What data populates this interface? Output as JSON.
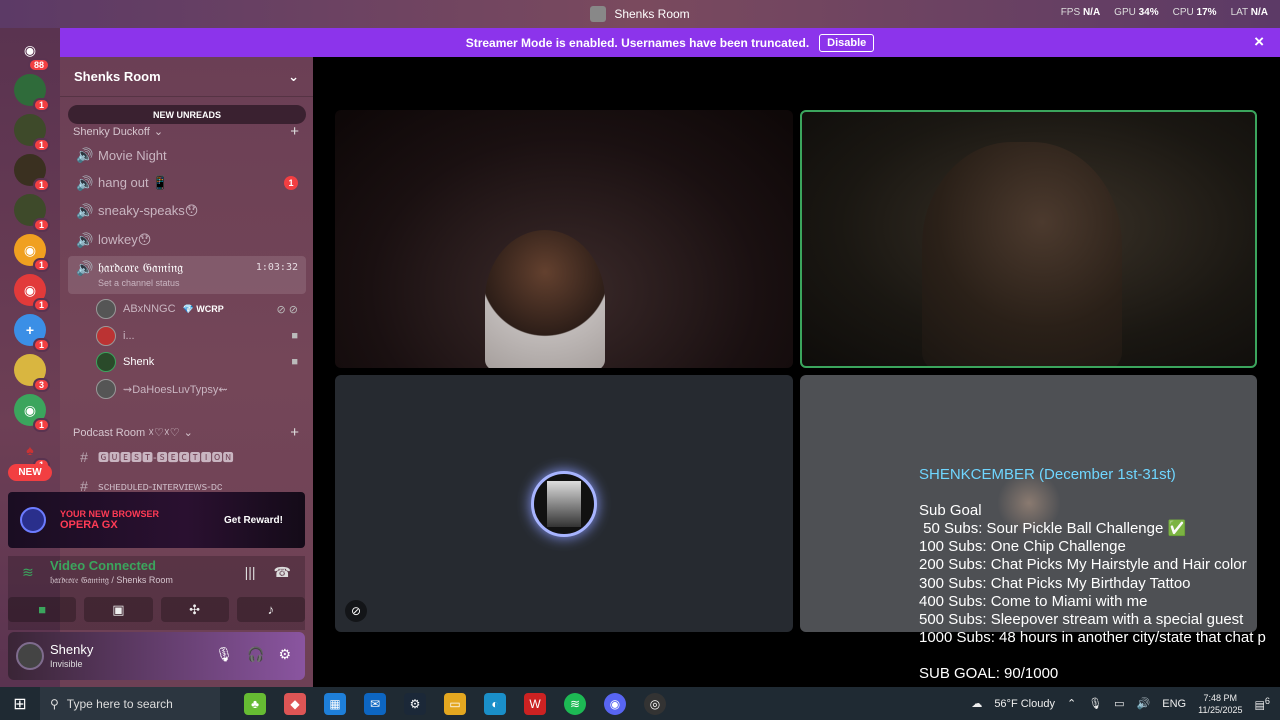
{
  "window": {
    "title": "Shenks Room"
  },
  "perf": {
    "fps_label": "FPS",
    "fps": "N/A",
    "gpu_label": "GPU",
    "gpu": "34%",
    "cpu_label": "CPU",
    "cpu": "17%",
    "lat_label": "LAT",
    "lat": "N/A"
  },
  "banner": {
    "message": "Streamer Mode is enabled. Usernames have been truncated.",
    "disable": "Disable",
    "close": "×"
  },
  "rail": {
    "home_badge": "88",
    "servers": [
      {
        "label": "1",
        "badge": "1"
      },
      {
        "label": "1",
        "badge": "1"
      },
      {
        "label": "1",
        "badge": "1"
      },
      {
        "label": "1",
        "badge": "1"
      },
      {
        "label": "1",
        "badge": "1"
      },
      {
        "label": "1",
        "badge": "1"
      },
      {
        "label": "1",
        "badge": "1"
      },
      {
        "label": "3",
        "badge": "3"
      },
      {
        "label": "1",
        "badge": "1"
      },
      {
        "label": "1",
        "badge": "1"
      }
    ],
    "new_label": "NEW"
  },
  "sidebar": {
    "server_name": "Shenks Room",
    "new_unreads": "NEW UNREADS",
    "category1": "Shenky Duckoff",
    "channels": [
      {
        "name": "Movie Night"
      },
      {
        "name": "hang out 📱",
        "badge": "1"
      },
      {
        "name": "sneaky-speaks😯"
      },
      {
        "name": "lowkey😯"
      }
    ],
    "active_channel": {
      "name": "𝔥𝔞𝔯𝔡𝔠𝔬𝔯𝔢 𝔊𝔞𝔪𝔦𝔫𝔤",
      "timer": "1:03:32",
      "status": "Set a channel status"
    },
    "voice_users": [
      {
        "name": "ABxNNGC",
        "tag": "💎 WCRP"
      },
      {
        "name": "i..."
      },
      {
        "name": "Shenk"
      },
      {
        "name": "⇝DaHoesLuvTypsy⇜"
      }
    ],
    "category2": "Podcast Room ☓♡☓♡",
    "text_channels": [
      {
        "name": "🅶🆄🅴🆂🆃-🆂🅴🅲🆃🅸🅾🅽"
      },
      {
        "name": "ꜱᴄʜᴇᴅᴜʟᴇᴅ-ɪɴᴛᴇʀᴠɪᴇᴡꜱ-ᴅᴄ"
      }
    ]
  },
  "ad": {
    "brand": "OPERA GX",
    "tagline": "YOUR NEW BROWSER",
    "cta": "Get Reward!"
  },
  "voice": {
    "status": "Video Connected",
    "location": "𝔥𝔞𝔯𝔡𝔠𝔬𝔯𝔢 𝔊𝔞𝔪𝔦𝔫𝔤 / Shenks Room"
  },
  "userbar": {
    "name": "Shenky",
    "status": "Invisible"
  },
  "overlay": {
    "title": "SHENKCEMBER (December 1st-31st)",
    "sub_goal": "Sub Goal",
    "goals": [
      " 50 Subs: Sour Pickle Ball Challenge ✅",
      "100 Subs: One Chip Challenge",
      "200 Subs: Chat Picks My Hairstyle and Hair color",
      "300 Subs: Chat Picks My Birthday Tattoo",
      "400 Subs: Come to Miami with me",
      "500 Subs: Sleepover stream with a special guest",
      "1000 Subs: 48 hours in another city/state that chat p"
    ],
    "total": "SUB GOAL: 90/1000"
  },
  "taskbar": {
    "search_placeholder": "Type here to search",
    "weather": "56°F  Cloudy",
    "lang": "ENG",
    "time": "7:48 PM",
    "date": "11/25/2025",
    "notif": "6"
  }
}
